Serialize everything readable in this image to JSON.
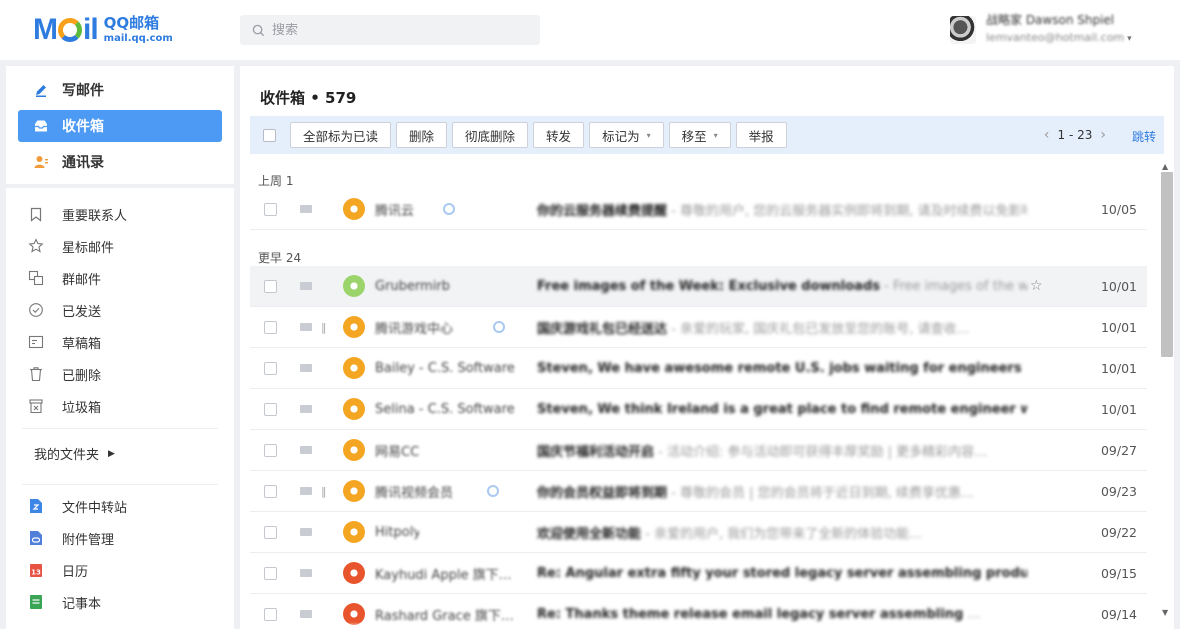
{
  "header": {
    "logo_letters": "M",
    "logo_letters_end": "il",
    "logo_brand": "QQ邮箱",
    "logo_url": "mail.qq.com",
    "search_placeholder": "搜索",
    "user_name": "战略家 Dawson Shpiel",
    "user_email": "lemvanteo@hotmail.com",
    "user_arrow": "▾"
  },
  "sidebar": {
    "main": [
      {
        "label": "写邮件",
        "icon": "pen-icon"
      },
      {
        "label": "收件箱",
        "icon": "inbox-icon",
        "active": true
      },
      {
        "label": "通讯录",
        "icon": "contacts-icon"
      }
    ],
    "folders": [
      {
        "label": "重要联系人",
        "icon": "bookmark-icon"
      },
      {
        "label": "星标邮件",
        "icon": "star-icon"
      },
      {
        "label": "群邮件",
        "icon": "group-mail-icon"
      },
      {
        "label": "已发送",
        "icon": "sent-check-icon"
      },
      {
        "label": "草稿箱",
        "icon": "draft-icon"
      },
      {
        "label": "已删除",
        "icon": "trash-icon"
      },
      {
        "label": "垃圾箱",
        "icon": "spam-bin-icon"
      }
    ],
    "my_folders_label": "我的文件夹",
    "my_folders_arrow": "▶",
    "apps": [
      {
        "label": "文件中转站",
        "icon": "file-transfer-icon",
        "color": "#3e86e6"
      },
      {
        "label": "附件管理",
        "icon": "attachment-manager-icon",
        "color": "#4f7fd9"
      },
      {
        "label": "日历",
        "icon": "calendar-icon",
        "color": "#e85444",
        "badge": "13"
      },
      {
        "label": "记事本",
        "icon": "notepad-icon",
        "color": "#3aa655"
      }
    ]
  },
  "main": {
    "title": "收件箱 • 579",
    "toolbar": {
      "mark_all_read": "全部标为已读",
      "delete": "删除",
      "delete_permanently": "彻底删除",
      "forward": "转发",
      "mark_as": "标记为",
      "move_to": "移至",
      "report": "举报",
      "pager_prev": "‹",
      "pager_text": "1 - 23",
      "pager_next": "›",
      "jump": "跳转",
      "caret": "▾"
    },
    "groups": [
      {
        "label": "上周 1"
      },
      {
        "label": "更早 24"
      }
    ],
    "emails": [
      {
        "sender": "腾讯云",
        "subject": "你的云服务器续费提醒",
        "preview": " - 尊敬的用户, 您的云服务器实例即将到期, 请及时续费以免影响…",
        "date": "10/05",
        "avatar_color": "#f4a623",
        "qq_badge": true,
        "attachment": false
      },
      {
        "sender": "Grubermirbl",
        "subject": "Free images of the Week: Exclusive downloads",
        "preview": " - Free images of the week for your design projects…",
        "date": "10/01",
        "avatar_color": "#9bd46a",
        "qq_badge": false,
        "attachment": false,
        "hover": true
      },
      {
        "sender": "腾讯游戏中心",
        "subject": "国庆游戏礼包已经送达",
        "preview": " - 亲爱的玩家, 国庆礼包已发放至您的账号, 请查收…",
        "date": "10/01",
        "avatar_color": "#f4a623",
        "qq_badge": true,
        "attachment": true
      },
      {
        "sender": "Bailey - C.S. Software",
        "subject": "Steven, We have awesome remote U.S. jobs waiting for engineers like you",
        "preview": " …",
        "date": "10/01",
        "avatar_color": "#f4a623",
        "qq_badge": false,
        "attachment": false
      },
      {
        "sender": "Selina - C.S. Software",
        "subject": "Steven, We think Ireland is a great place to find remote engineer work",
        "preview": " …",
        "date": "10/01",
        "avatar_color": "#f4a623",
        "qq_badge": false,
        "attachment": false
      },
      {
        "sender": "网易CC",
        "subject": "国庆节福利活动开启",
        "preview": " - 活动介绍: 参与活动即可获得丰厚奖励 | 更多精彩内容…",
        "date": "09/27",
        "avatar_color": "#f4a623",
        "qq_badge": false,
        "attachment": false
      },
      {
        "sender": "腾讯视频会员",
        "subject": "你的会员权益即将到期",
        "preview": " - 尊敬的会员 | 您的会员将于近日到期, 续费享优惠…",
        "date": "09/23",
        "avatar_color": "#f4a623",
        "qq_badge": true,
        "attachment": true
      },
      {
        "sender": "Hitpoly",
        "subject": "欢迎使用全新功能",
        "preview": " - 亲爱的用户, 我们为您带来了全新的体验功能…",
        "date": "09/22",
        "avatar_color": "#f4a623",
        "qq_badge": false,
        "attachment": false
      },
      {
        "sender": "Kayhudi Apple 旗下…",
        "subject": "Re: Angular extra fifty your stored legacy server assembling products",
        "preview": " …",
        "date": "09/15",
        "avatar_color": "#e8542b",
        "qq_badge": false,
        "attachment": false
      },
      {
        "sender": "Rashard Grace 旗下…",
        "subject": "Re: Thanks theme release email legacy server assembling",
        "preview": " …",
        "date": "09/14",
        "avatar_color": "#e8542b",
        "qq_badge": false,
        "attachment": false
      }
    ]
  },
  "colors": {
    "accent": "#4d9af4",
    "link": "#2f7ce0",
    "toolbar_bg": "#e5eefb"
  }
}
